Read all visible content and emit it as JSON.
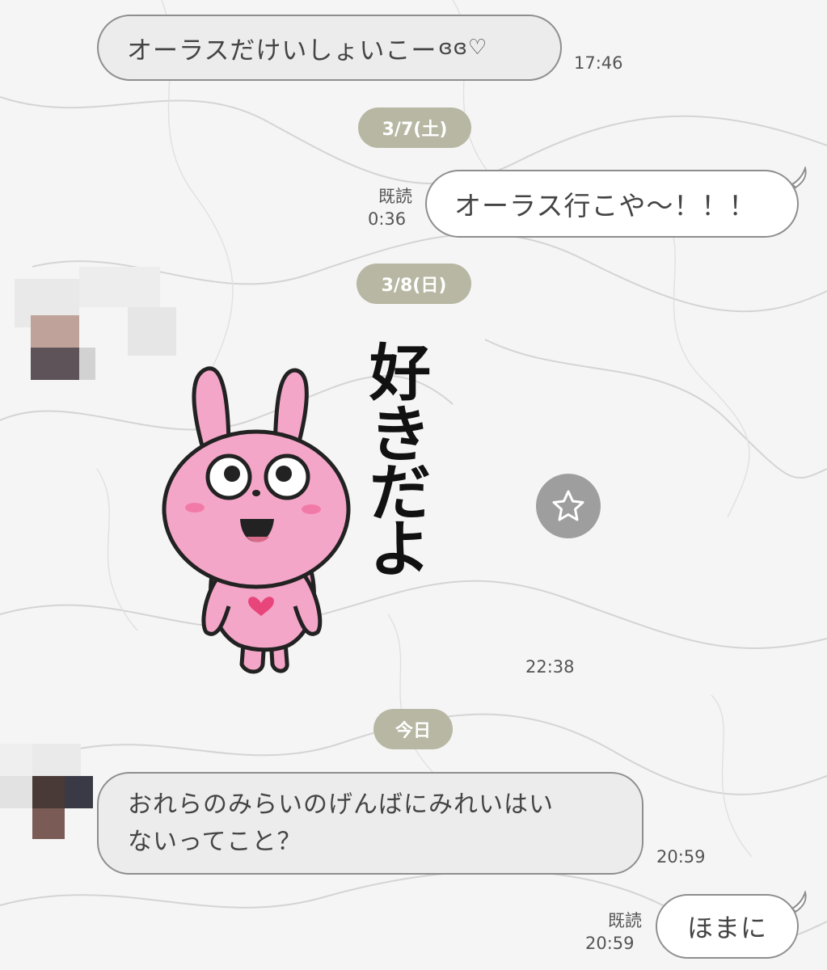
{
  "messages": [
    {
      "text": "オーラスだけいしょいこー",
      "deco": "ɞɞ♡",
      "time": "17:46"
    },
    {
      "text": "オーラス行こや〜！！！",
      "read": "既読",
      "time": "0:36"
    },
    {
      "time": "22:38"
    },
    {
      "line1": "おれらのみらいのげんばにみれいはい",
      "line2": "ないってこと？",
      "time": "20:59"
    },
    {
      "text": "ほまに",
      "read": "既読",
      "time": "20:59"
    }
  ],
  "dates": [
    "3/7(土)",
    "3/8(日)",
    "今日"
  ],
  "sticker": {
    "text_chars": [
      "好",
      "き",
      "だ",
      "よ"
    ],
    "icon": "pink-rabbit-sticker"
  },
  "actions": {
    "favorite_icon": "star-outline-icon"
  },
  "colors": {
    "date_chip": "#b8b7a3",
    "bubble_border": "#8e8e8e",
    "rabbit_pink": "#f4a6c8"
  }
}
